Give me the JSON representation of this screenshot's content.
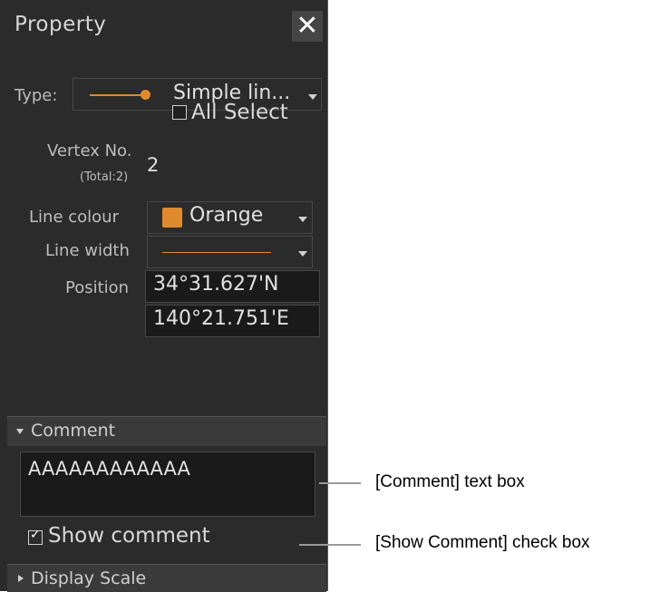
{
  "panel": {
    "title": "Property",
    "close_icon": "close-icon",
    "type": {
      "label": "Type:",
      "value": "Simple lin...",
      "line_color": "#e08a2e"
    },
    "all_select": {
      "label": "All Select",
      "checked": false
    },
    "vertex": {
      "label": "Vertex No.",
      "total": "(Total:2)",
      "value": "2"
    },
    "line_colour": {
      "label": "Line colour",
      "value": "Orange",
      "swatch": "#e08a2e"
    },
    "line_width": {
      "label": "Line width",
      "line_color": "#e08a2e"
    },
    "position": {
      "label": "Position",
      "lat": "34°31.627'N",
      "lon": "140°21.751'E"
    },
    "comment": {
      "header": "Comment",
      "text": "AAAAAAAAAAAA"
    },
    "show_comment": {
      "label": "Show comment",
      "checked": true
    },
    "display_scale": {
      "header": "Display Scale"
    }
  },
  "callouts": {
    "comment_box": "[Comment] text box",
    "show_comment_box": "[Show Comment] check box"
  }
}
